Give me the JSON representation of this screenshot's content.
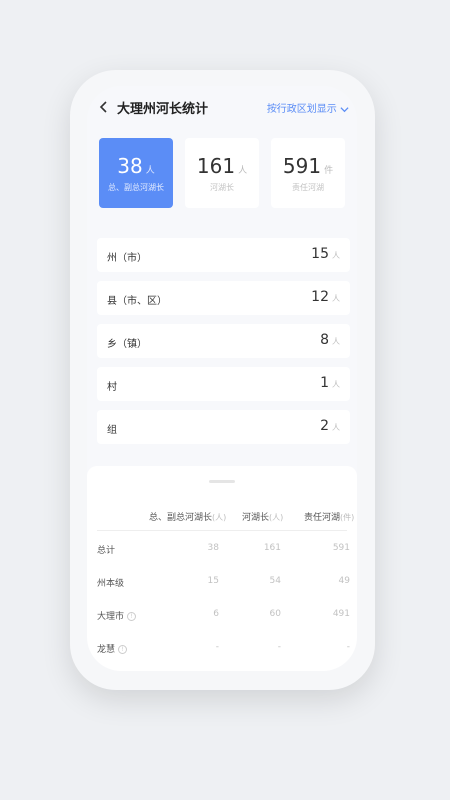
{
  "header": {
    "title": "大理州河长统计",
    "switch_label": "按行政区划显示"
  },
  "stats": [
    {
      "value": "38",
      "unit": "人",
      "label": "总、副总河湖长"
    },
    {
      "value": "161",
      "unit": "人",
      "label": "河湖长"
    },
    {
      "value": "591",
      "unit": "件",
      "label": "责任河湖"
    }
  ],
  "levels": [
    {
      "label": "州（市）",
      "value": "15",
      "unit": "人"
    },
    {
      "label": "县（市、区）",
      "value": "12",
      "unit": "人"
    },
    {
      "label": "乡（镇）",
      "value": "8",
      "unit": "人"
    },
    {
      "label": "村",
      "value": "1",
      "unit": "人"
    },
    {
      "label": "组",
      "value": "2",
      "unit": "人"
    }
  ],
  "table": {
    "headers": [
      {
        "label": "总、副总河湖长",
        "unit": "(人)"
      },
      {
        "label": "河湖长",
        "unit": "(人)"
      },
      {
        "label": "责任河湖",
        "unit": "(件)"
      }
    ],
    "rows": [
      {
        "name": "总计",
        "a": "38",
        "b": "161",
        "c": "591"
      },
      {
        "name": "州本级",
        "a": "15",
        "b": "54",
        "c": "49"
      },
      {
        "name": "大理市",
        "a": "6",
        "b": "60",
        "c": "491"
      },
      {
        "name": "龙慧",
        "a": "-",
        "b": "-",
        "c": "-"
      }
    ]
  }
}
